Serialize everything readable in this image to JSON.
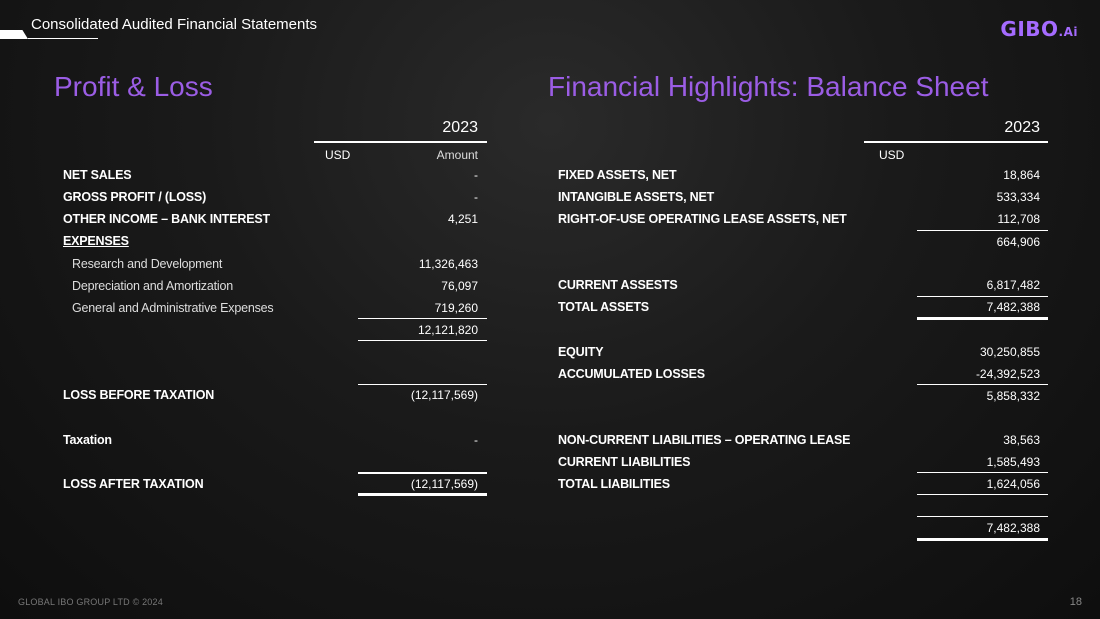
{
  "header": {
    "title": "Consolidated Audited Financial Statements",
    "logo": "GIBO",
    "logo_suffix": ".Ai"
  },
  "pl": {
    "title": "Profit & Loss",
    "year": "2023",
    "col_usd": "USD",
    "col_amount": "Amount",
    "rows": [
      {
        "label": "NET SALES",
        "value": "-"
      },
      {
        "label": "GROSS PROFIT / (LOSS)",
        "value": "-"
      },
      {
        "label": "OTHER INCOME – BANK INTEREST",
        "value": "4,251"
      },
      {
        "label": "EXPENSES",
        "value": ""
      },
      {
        "label": "Research and Development",
        "value": "11,326,463"
      },
      {
        "label": "Depreciation and Amortization",
        "value": "76,097"
      },
      {
        "label": "General and Administrative Expenses",
        "value": "719,260"
      },
      {
        "label": "",
        "value": "12,121,820"
      },
      {
        "label": "LOSS BEFORE TAXATION",
        "value": "(12,117,569)"
      },
      {
        "label": "Taxation",
        "value": "-"
      },
      {
        "label": "LOSS AFTER TAXATION",
        "value": "(12,117,569)"
      }
    ]
  },
  "bs": {
    "title": "Financial Highlights: Balance Sheet",
    "year": "2023",
    "col_usd": "USD",
    "rows": [
      {
        "label": "FIXED ASSETS, NET",
        "value": "18,864"
      },
      {
        "label": "INTANGIBLE ASSETS, NET",
        "value": "533,334"
      },
      {
        "label": "RIGHT-OF-USE OPERATING LEASE ASSETS, NET",
        "value": "112,708"
      },
      {
        "label": "",
        "value": "664,906"
      },
      {
        "label": "CURRENT ASSESTS",
        "value": "6,817,482"
      },
      {
        "label": "TOTAL ASSETS",
        "value": "7,482,388"
      },
      {
        "label": "EQUITY",
        "value": "30,250,855"
      },
      {
        "label": "ACCUMULATED LOSSES",
        "value": "-24,392,523"
      },
      {
        "label": "",
        "value": "5,858,332"
      },
      {
        "label": "NON-CURRENT LIABILITIES – OPERATING LEASE",
        "value": "38,563"
      },
      {
        "label": "CURRENT LIABILITIES",
        "value": "1,585,493"
      },
      {
        "label": "TOTAL LIABILITIES",
        "value": "1,624,056"
      },
      {
        "label": "",
        "value": "7,482,388"
      }
    ]
  },
  "footer": {
    "text": "GLOBAL IBO GROUP LTD © 2024",
    "page": "18"
  }
}
